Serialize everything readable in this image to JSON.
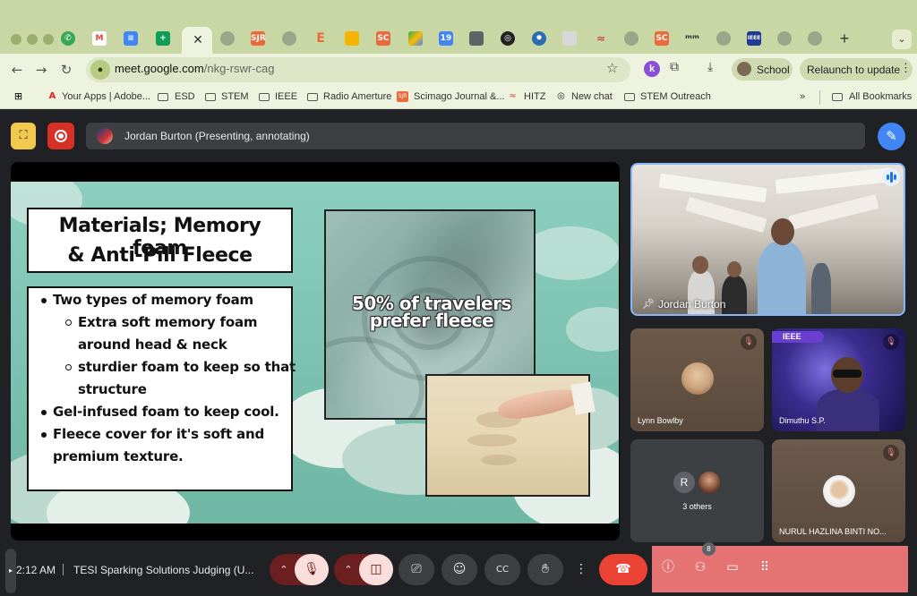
{
  "browser": {
    "url_host": "meet.google.com",
    "url_path": "/nkg-rswr-cag",
    "profile_name": "School",
    "relaunch_label": "Relaunch to update",
    "tab_favicons": [
      "G",
      "M",
      "D",
      "S",
      "",
      "",
      "SJR",
      "",
      "E",
      "",
      "SC",
      "",
      "19",
      "",
      "",
      "",
      "",
      "",
      "",
      "",
      "SC",
      "",
      "",
      "",
      "IEEE",
      "",
      ""
    ]
  },
  "bookmarks": {
    "items": [
      {
        "label": "Your Apps | Adobe...",
        "icon": "adobe-icon"
      },
      {
        "label": "ESD",
        "icon": "folder-icon"
      },
      {
        "label": "STEM",
        "icon": "folder-icon"
      },
      {
        "label": "IEEE",
        "icon": "folder-icon"
      },
      {
        "label": "Radio Amerture",
        "icon": "folder-icon"
      },
      {
        "label": "Scimago Journal &...",
        "icon": "sjr-icon"
      },
      {
        "label": "HITZ",
        "icon": "hitz-icon"
      },
      {
        "label": "New chat",
        "icon": "openai-icon"
      },
      {
        "label": "STEM Outreach",
        "icon": "folder-icon"
      }
    ],
    "overflow": "»",
    "all_bookmarks": "All Bookmarks"
  },
  "meet": {
    "presenter_label": "Jordan Burton (Presenting, annotating)",
    "slide": {
      "title_line1": "Materials; Memory foam",
      "title_line2": "&  Anti-Pill Fleece",
      "bullets": [
        {
          "text": "Two types of memory foam",
          "level": 1
        },
        {
          "text": "Extra soft memory foam",
          "level": 2
        },
        {
          "text": "around head & neck",
          "level": 2
        },
        {
          "text": "sturdier foam to keep so that",
          "level": 2
        },
        {
          "text": "structure",
          "level": 2
        },
        {
          "text": "Gel-infused foam to keep cool.",
          "level": 1
        },
        {
          "text": "Fleece cover for it's soft and",
          "level": 1
        },
        {
          "text": "premium texture.",
          "level": 1
        }
      ],
      "fleece_caption_line1": "50% of travelers",
      "fleece_caption_line2": "prefer fleece"
    },
    "participants": {
      "featured": "Jordan Burton",
      "lynn": "Lynn Bowlby",
      "dimuthu": "Dimuthu S.P.",
      "dimuthu_tag": "IEEE",
      "others_initial": "R",
      "others": "3 others",
      "nurul": "NURUL HAZLINA BINTI NO..."
    },
    "bottom": {
      "time": "2:12 AM",
      "meeting_title": "TESI Sparking Solutions Judging (U...",
      "people_count": "8"
    }
  },
  "colors": {
    "accent": "#4285f4",
    "hangup": "#ea4335",
    "record": "#d93025",
    "chrome_theme": "#c8d7a4"
  }
}
